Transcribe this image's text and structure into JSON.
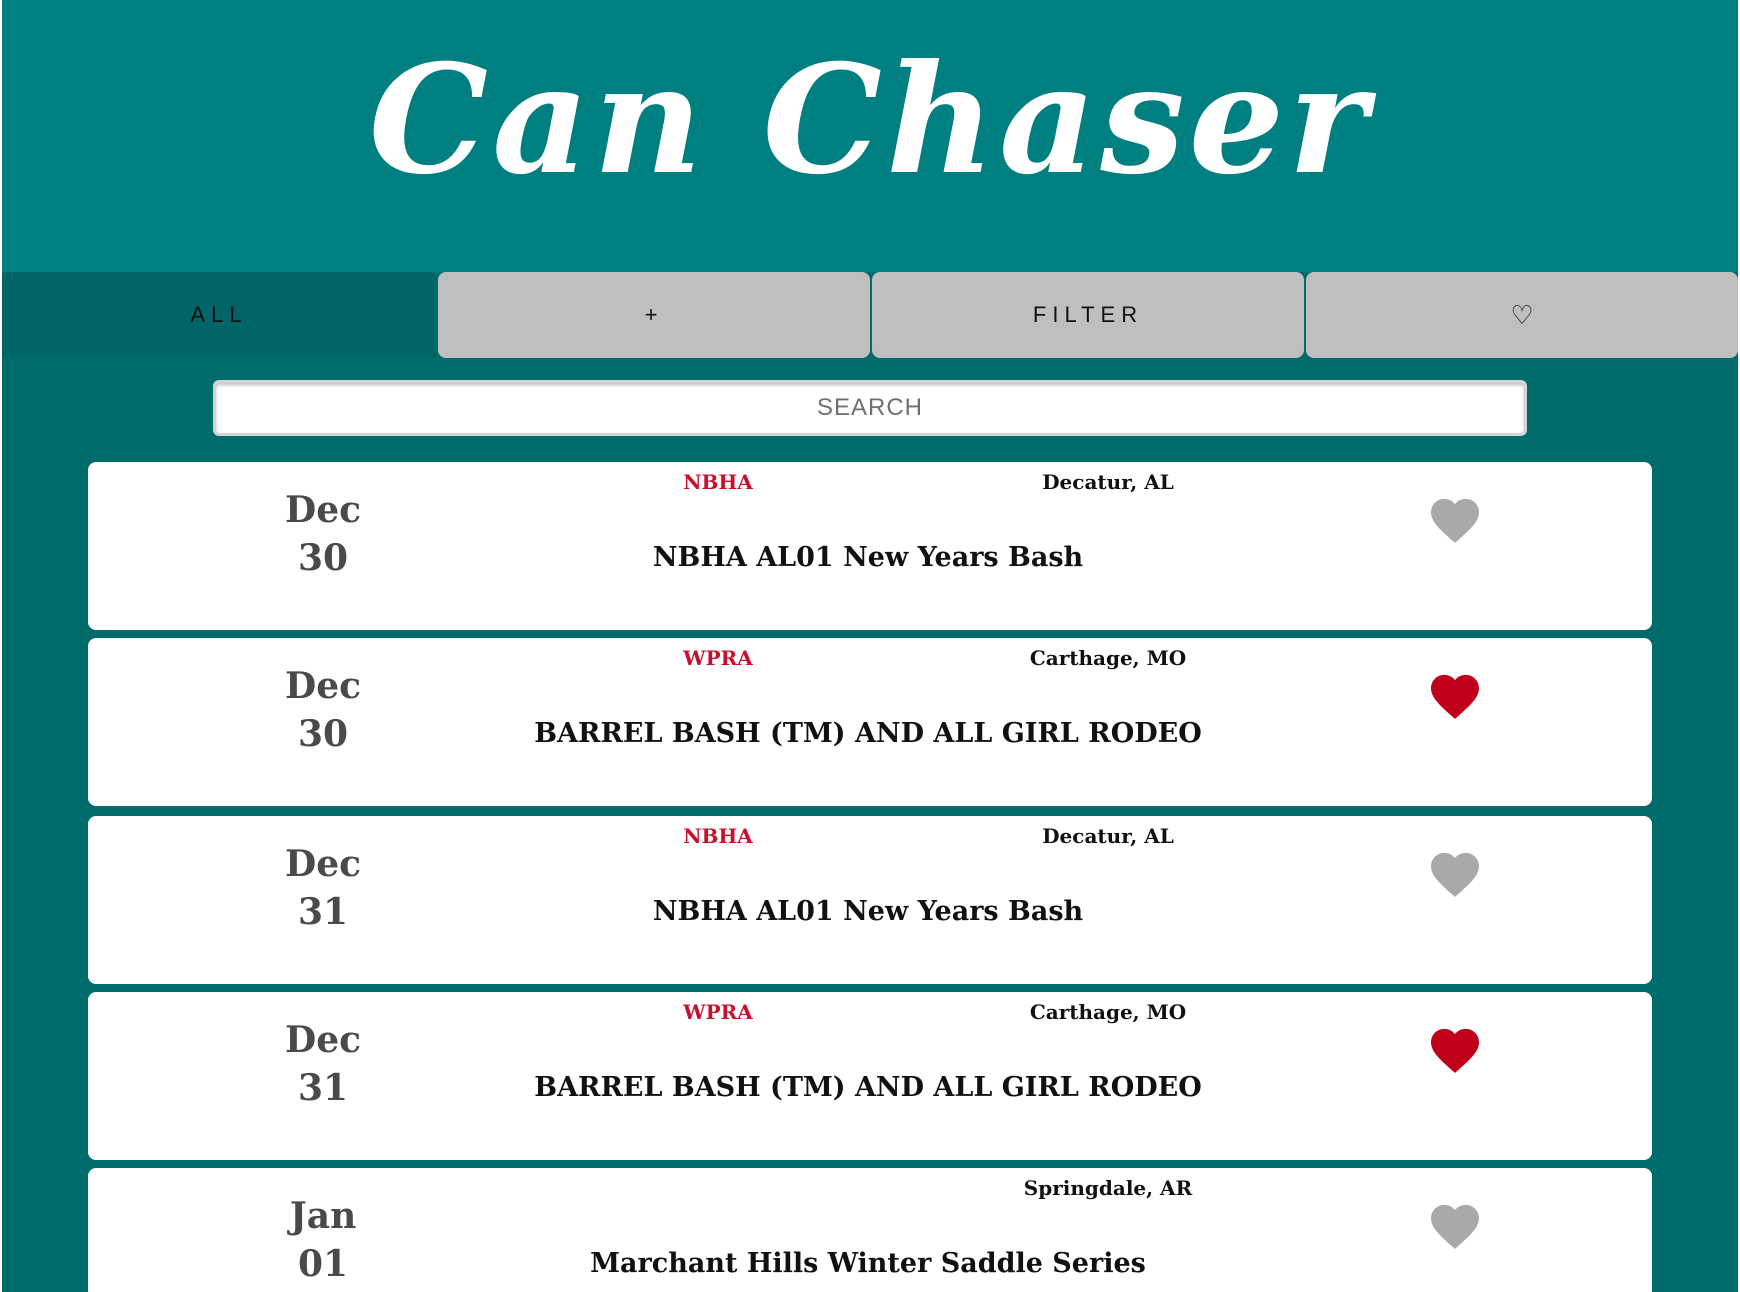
{
  "app": {
    "title": "Can Chaser"
  },
  "tabs": [
    {
      "label": "ALL",
      "active": true
    },
    {
      "label": "+",
      "active": false
    },
    {
      "label": "FILTER",
      "active": false
    },
    {
      "label": "♡",
      "active": false
    }
  ],
  "search": {
    "placeholder": "SEARCH",
    "value": ""
  },
  "colors": {
    "header": "#007f80",
    "main": "#016a6b",
    "assoc_text": "#c8102e",
    "favorite_on": "#c0001a",
    "favorite_off": "#a9a9a9"
  },
  "events": [
    {
      "month": "Dec",
      "day": "30",
      "association": "NBHA",
      "location": "Decatur, AL",
      "name": "NBHA AL01 New Years Bash",
      "favorite": false
    },
    {
      "month": "Dec",
      "day": "30",
      "association": "WPRA",
      "location": "Carthage, MO",
      "name": "BARREL BASH (TM) AND ALL GIRL RODEO",
      "favorite": true
    },
    {
      "month": "Dec",
      "day": "31",
      "association": "NBHA",
      "location": "Decatur, AL",
      "name": "NBHA AL01 New Years Bash",
      "favorite": false
    },
    {
      "month": "Dec",
      "day": "31",
      "association": "WPRA",
      "location": "Carthage, MO",
      "name": "BARREL BASH (TM) AND ALL GIRL RODEO",
      "favorite": true
    },
    {
      "month": "Jan",
      "day": "01",
      "association": "",
      "location": "Springdale, AR",
      "name": "Marchant Hills Winter Saddle Series",
      "favorite": false
    }
  ]
}
